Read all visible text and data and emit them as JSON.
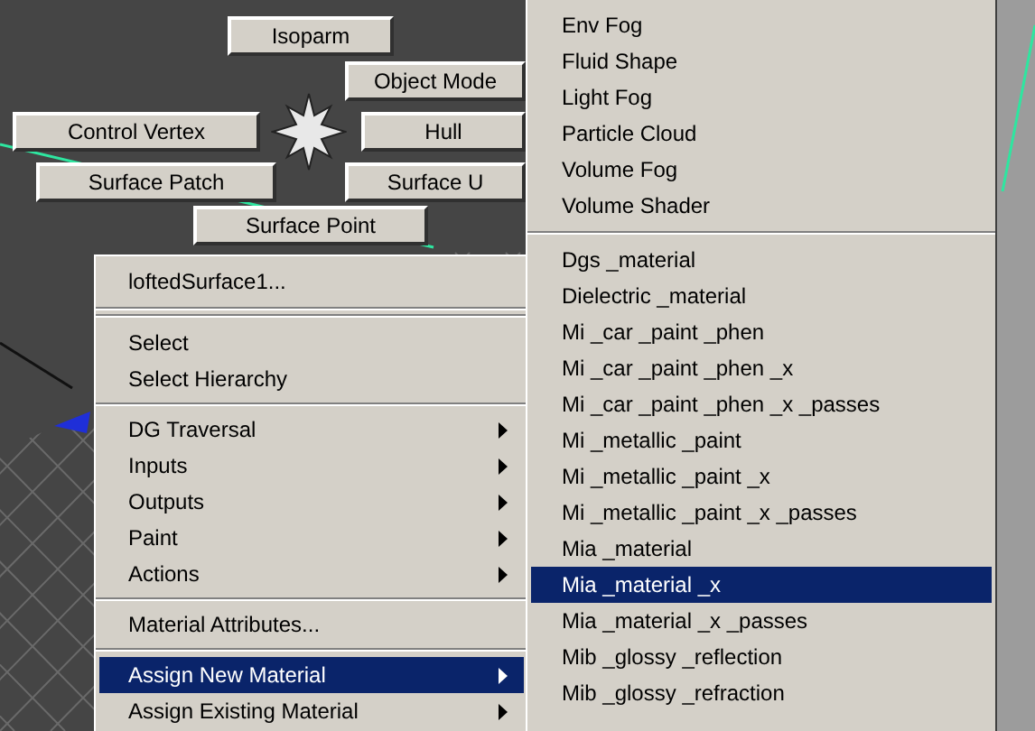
{
  "marking_menu": [
    {
      "label": "Isoparm"
    },
    {
      "label": "Object Mode"
    },
    {
      "label": "Control Vertex"
    },
    {
      "label": "Hull"
    },
    {
      "label": "Surface Patch"
    },
    {
      "label": "Surface U"
    },
    {
      "label": "Surface Point"
    }
  ],
  "context_menu": [
    {
      "kind": "item",
      "label": "loftedSurface1...",
      "submenu": false,
      "selected": false
    },
    {
      "kind": "double-separator"
    },
    {
      "kind": "item",
      "label": "Select",
      "submenu": false,
      "selected": false
    },
    {
      "kind": "item",
      "label": "Select Hierarchy",
      "submenu": false,
      "selected": false
    },
    {
      "kind": "separator"
    },
    {
      "kind": "item",
      "label": "DG Traversal",
      "submenu": true,
      "selected": false
    },
    {
      "kind": "item",
      "label": "Inputs",
      "submenu": true,
      "selected": false
    },
    {
      "kind": "item",
      "label": "Outputs",
      "submenu": true,
      "selected": false
    },
    {
      "kind": "item",
      "label": "Paint",
      "submenu": true,
      "selected": false
    },
    {
      "kind": "item",
      "label": "Actions",
      "submenu": true,
      "selected": false
    },
    {
      "kind": "separator"
    },
    {
      "kind": "item",
      "label": "Material Attributes...",
      "submenu": false,
      "selected": false
    },
    {
      "kind": "separator"
    },
    {
      "kind": "item",
      "label": "Assign New Material",
      "submenu": true,
      "selected": true
    },
    {
      "kind": "item",
      "label": "Assign Existing Material",
      "submenu": true,
      "selected": false
    }
  ],
  "submenu": [
    {
      "kind": "item",
      "label": "Env Fog",
      "selected": false
    },
    {
      "kind": "item",
      "label": "Fluid Shape",
      "selected": false
    },
    {
      "kind": "item",
      "label": "Light Fog",
      "selected": false
    },
    {
      "kind": "item",
      "label": "Particle Cloud",
      "selected": false
    },
    {
      "kind": "item",
      "label": "Volume Fog",
      "selected": false
    },
    {
      "kind": "item",
      "label": "Volume Shader",
      "selected": false
    },
    {
      "kind": "separator"
    },
    {
      "kind": "item",
      "label": "Dgs _material",
      "selected": false
    },
    {
      "kind": "item",
      "label": "Dielectric _material",
      "selected": false
    },
    {
      "kind": "item",
      "label": "Mi _car _paint _phen",
      "selected": false
    },
    {
      "kind": "item",
      "label": "Mi _car _paint _phen _x",
      "selected": false
    },
    {
      "kind": "item",
      "label": "Mi _car _paint _phen _x _passes",
      "selected": false
    },
    {
      "kind": "item",
      "label": "Mi _metallic _paint",
      "selected": false
    },
    {
      "kind": "item",
      "label": "Mi _metallic _paint _x",
      "selected": false
    },
    {
      "kind": "item",
      "label": "Mi _metallic _paint _x _passes",
      "selected": false
    },
    {
      "kind": "item",
      "label": "Mia _material",
      "selected": false
    },
    {
      "kind": "item",
      "label": "Mia _material _x",
      "selected": true
    },
    {
      "kind": "item",
      "label": "Mia _material _x _passes",
      "selected": false
    },
    {
      "kind": "item",
      "label": "Mib _glossy _reflection",
      "selected": false
    },
    {
      "kind": "item",
      "label": "Mib _glossy _refraction",
      "selected": false
    }
  ]
}
